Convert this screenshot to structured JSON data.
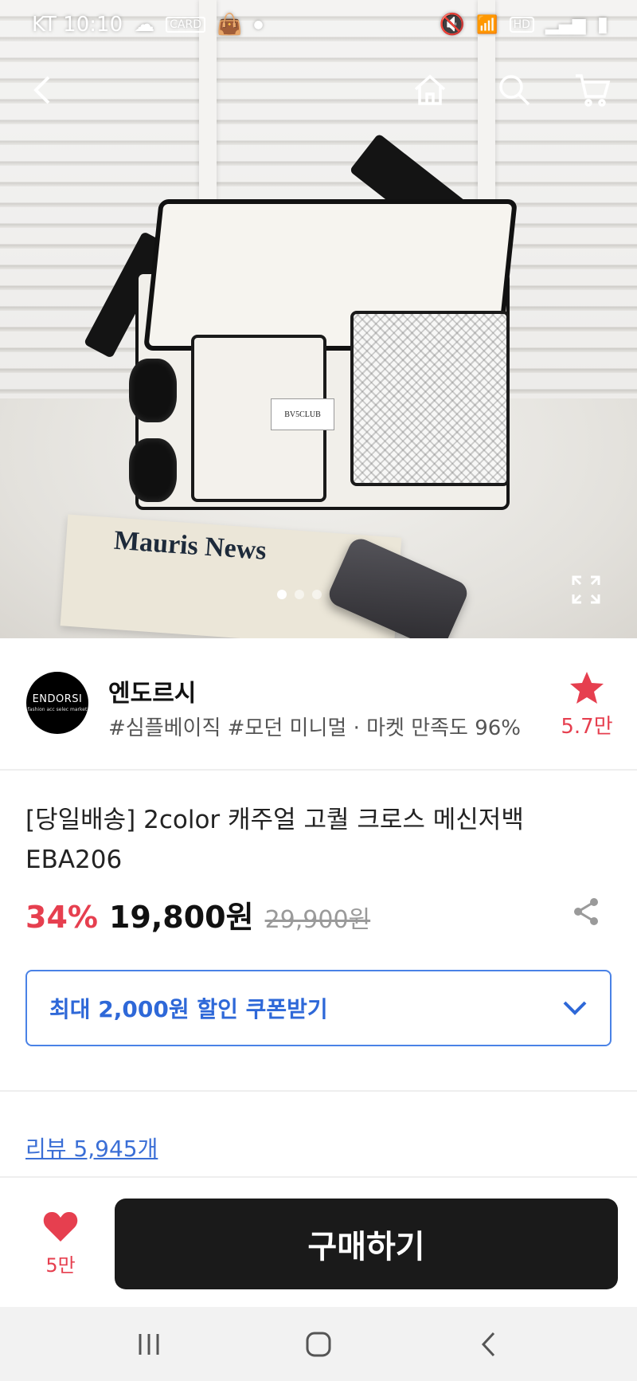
{
  "status_bar": {
    "carrier_time": "KT 10:10",
    "network_badge": "HD"
  },
  "hero": {
    "bag_label": "BV5CLUB",
    "newspaper_title": "Mauris News",
    "carousel": {
      "total": 3,
      "active_index": 0
    }
  },
  "seller": {
    "logo_text": "ENDORSI",
    "logo_subtext": "fashion acc selec market",
    "name": "엔도르시",
    "tags": "#심플베이직 #모던 미니멀 · 마켓 만족도 96%",
    "favorite_count": "5.7만"
  },
  "product": {
    "title": "[당일배송] 2color 캐주얼 고퀄 크로스 메신저백 EBA206",
    "discount": "34%",
    "price": "19,800원",
    "original_price": "29,900원"
  },
  "coupon": {
    "label": "최대 2,000원 할인 쿠폰받기"
  },
  "review": {
    "label": "리뷰 5,945개"
  },
  "action_bar": {
    "like_count": "5만",
    "buy_label": "구매하기"
  },
  "colors": {
    "accent_red": "#e63f4f",
    "accent_blue": "#2e68d8",
    "buy_button": "#1a1a1a"
  }
}
